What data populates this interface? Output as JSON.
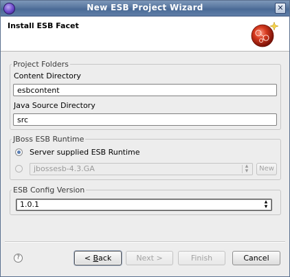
{
  "window": {
    "title": "New ESB Project Wizard",
    "close_icon": "close-icon"
  },
  "banner": {
    "title": "Install ESB Facet",
    "logo_icon": "jboss-esb-logo-icon"
  },
  "project_folders": {
    "legend": "Project Folders",
    "content_dir_label": "Content Directory",
    "content_dir_value": "esbcontent",
    "java_src_label": "Java Source Directory",
    "java_src_value": "src"
  },
  "runtime": {
    "legend": "JBoss ESB Runtime",
    "option_server": "Server supplied ESB Runtime",
    "option_server_selected": true,
    "runtime_select_value": "jbossesb-4.3.GA",
    "new_button": "New"
  },
  "config_version": {
    "legend": "ESB Config Version",
    "selected": "1.0.1"
  },
  "footer": {
    "help_icon": "help-icon",
    "back_prefix": "<",
    "back_mnemonic": "B",
    "back_rest": "ack",
    "next": "Next >",
    "finish": "Finish",
    "cancel": "Cancel"
  }
}
